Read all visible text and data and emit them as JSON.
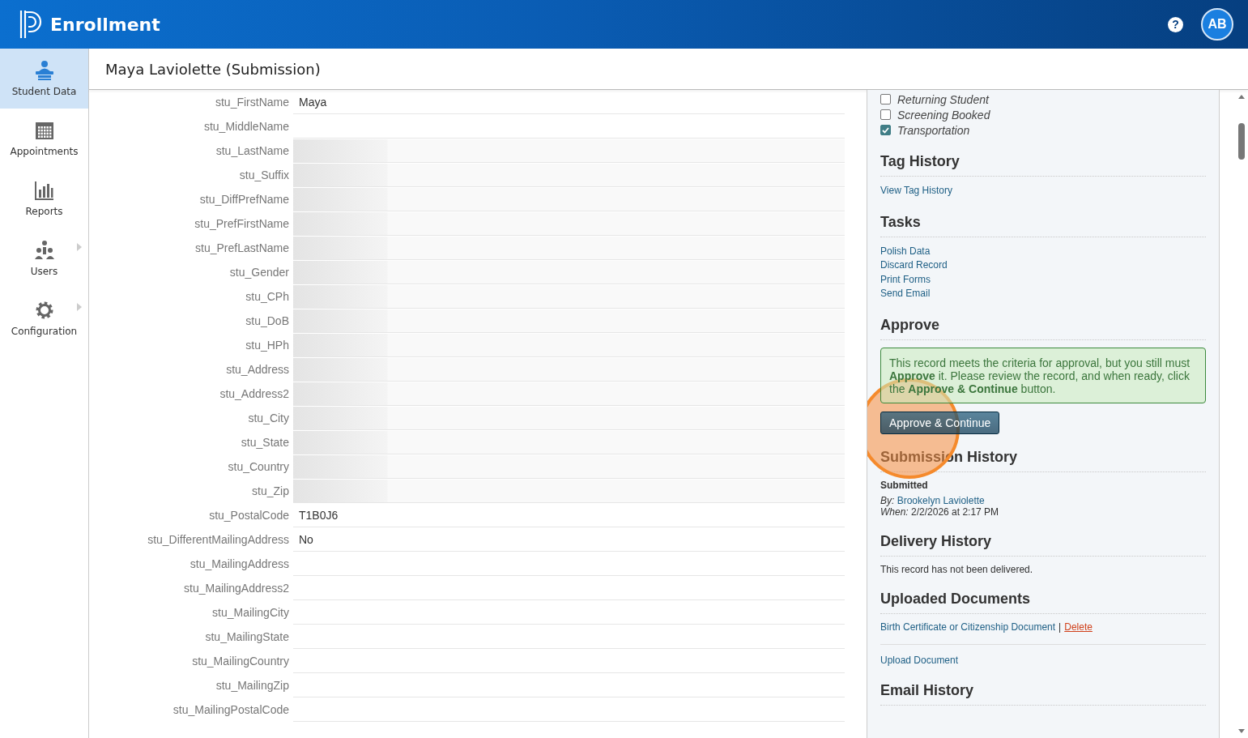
{
  "app": {
    "title": "Enrollment"
  },
  "header": {
    "help_label": "?",
    "avatar": "AB"
  },
  "sidebar": {
    "items": [
      {
        "label": "Student Data",
        "selected": true,
        "has_submenu": false
      },
      {
        "label": "Appointments",
        "selected": false,
        "has_submenu": false
      },
      {
        "label": "Reports",
        "selected": false,
        "has_submenu": false
      },
      {
        "label": "Users",
        "selected": false,
        "has_submenu": true
      },
      {
        "label": "Configuration",
        "selected": false,
        "has_submenu": true
      }
    ]
  },
  "page": {
    "title": "Maya Laviolette (Submission)"
  },
  "form": {
    "rows": [
      {
        "label": "stu_FirstName",
        "value": "Maya",
        "blurred": false
      },
      {
        "label": "stu_MiddleName",
        "blurred": false
      },
      {
        "label": "stu_LastName",
        "blurred": true
      },
      {
        "label": "stu_Suffix",
        "blurred": true
      },
      {
        "label": "stu_DiffPrefName",
        "blurred": true
      },
      {
        "label": "stu_PrefFirstName",
        "blurred": true
      },
      {
        "label": "stu_PrefLastName",
        "blurred": true
      },
      {
        "label": "stu_Gender",
        "blurred": true
      },
      {
        "label": "stu_CPh",
        "blurred": true
      },
      {
        "label": "stu_DoB",
        "blurred": true
      },
      {
        "label": "stu_HPh",
        "blurred": true
      },
      {
        "label": "stu_Address",
        "blurred": true
      },
      {
        "label": "stu_Address2",
        "blurred": true
      },
      {
        "label": "stu_City",
        "blurred": true
      },
      {
        "label": "stu_State",
        "blurred": true
      },
      {
        "label": "stu_Country",
        "blurred": true
      },
      {
        "label": "stu_Zip",
        "blurred": true
      },
      {
        "label": "stu_PostalCode",
        "value": "T1B0J6",
        "blurred": false
      },
      {
        "label": "stu_DifferentMailingAddress",
        "value": "No",
        "blurred": false
      },
      {
        "label": "stu_MailingAddress",
        "blurred": false
      },
      {
        "label": "stu_MailingAddress2",
        "blurred": false
      },
      {
        "label": "stu_MailingCity",
        "blurred": false
      },
      {
        "label": "stu_MailingState",
        "blurred": false
      },
      {
        "label": "stu_MailingCountry",
        "blurred": false
      },
      {
        "label": "stu_MailingZip",
        "blurred": false
      },
      {
        "label": "stu_MailingPostalCode",
        "blurred": false
      }
    ]
  },
  "panel": {
    "sections": [
      {
        "kind": "checklist",
        "items": [
          {
            "label": "Returning Student",
            "checked": false
          },
          {
            "label": "Screening Booked",
            "checked": false
          },
          {
            "label": "Transportation",
            "checked": true
          }
        ]
      },
      {
        "kind": "links",
        "heading": "Tag History",
        "links": [
          "View Tag History"
        ]
      },
      {
        "kind": "links",
        "heading": "Tasks",
        "links": [
          "Polish Data",
          "Discard Record",
          "Print Forms",
          "Send Email"
        ]
      },
      {
        "kind": "approve",
        "heading": "Approve",
        "message": "This record meets the criteria for approval, but you still must **Approve** it. Please review the record, and when ready, click the **Approve & Continue** button.",
        "button": "Approve & Continue",
        "click_highlight": true
      },
      {
        "kind": "history",
        "heading": "Submission History",
        "status": "Submitted",
        "by_label": "By:",
        "by": "Brookelyn Laviolette",
        "when_label": "When:",
        "when": "2/2/2026 at 2:17 PM"
      },
      {
        "kind": "text",
        "heading": "Delivery History",
        "text": "This record has not been delivered."
      },
      {
        "kind": "documents",
        "heading": "Uploaded Documents",
        "documents": [
          {
            "name": "Birth Certificate or Citizenship Document",
            "separator": "|",
            "action": "Delete"
          }
        ],
        "upload": "Upload Document"
      },
      {
        "kind": "heading",
        "heading": "Email History"
      }
    ]
  }
}
